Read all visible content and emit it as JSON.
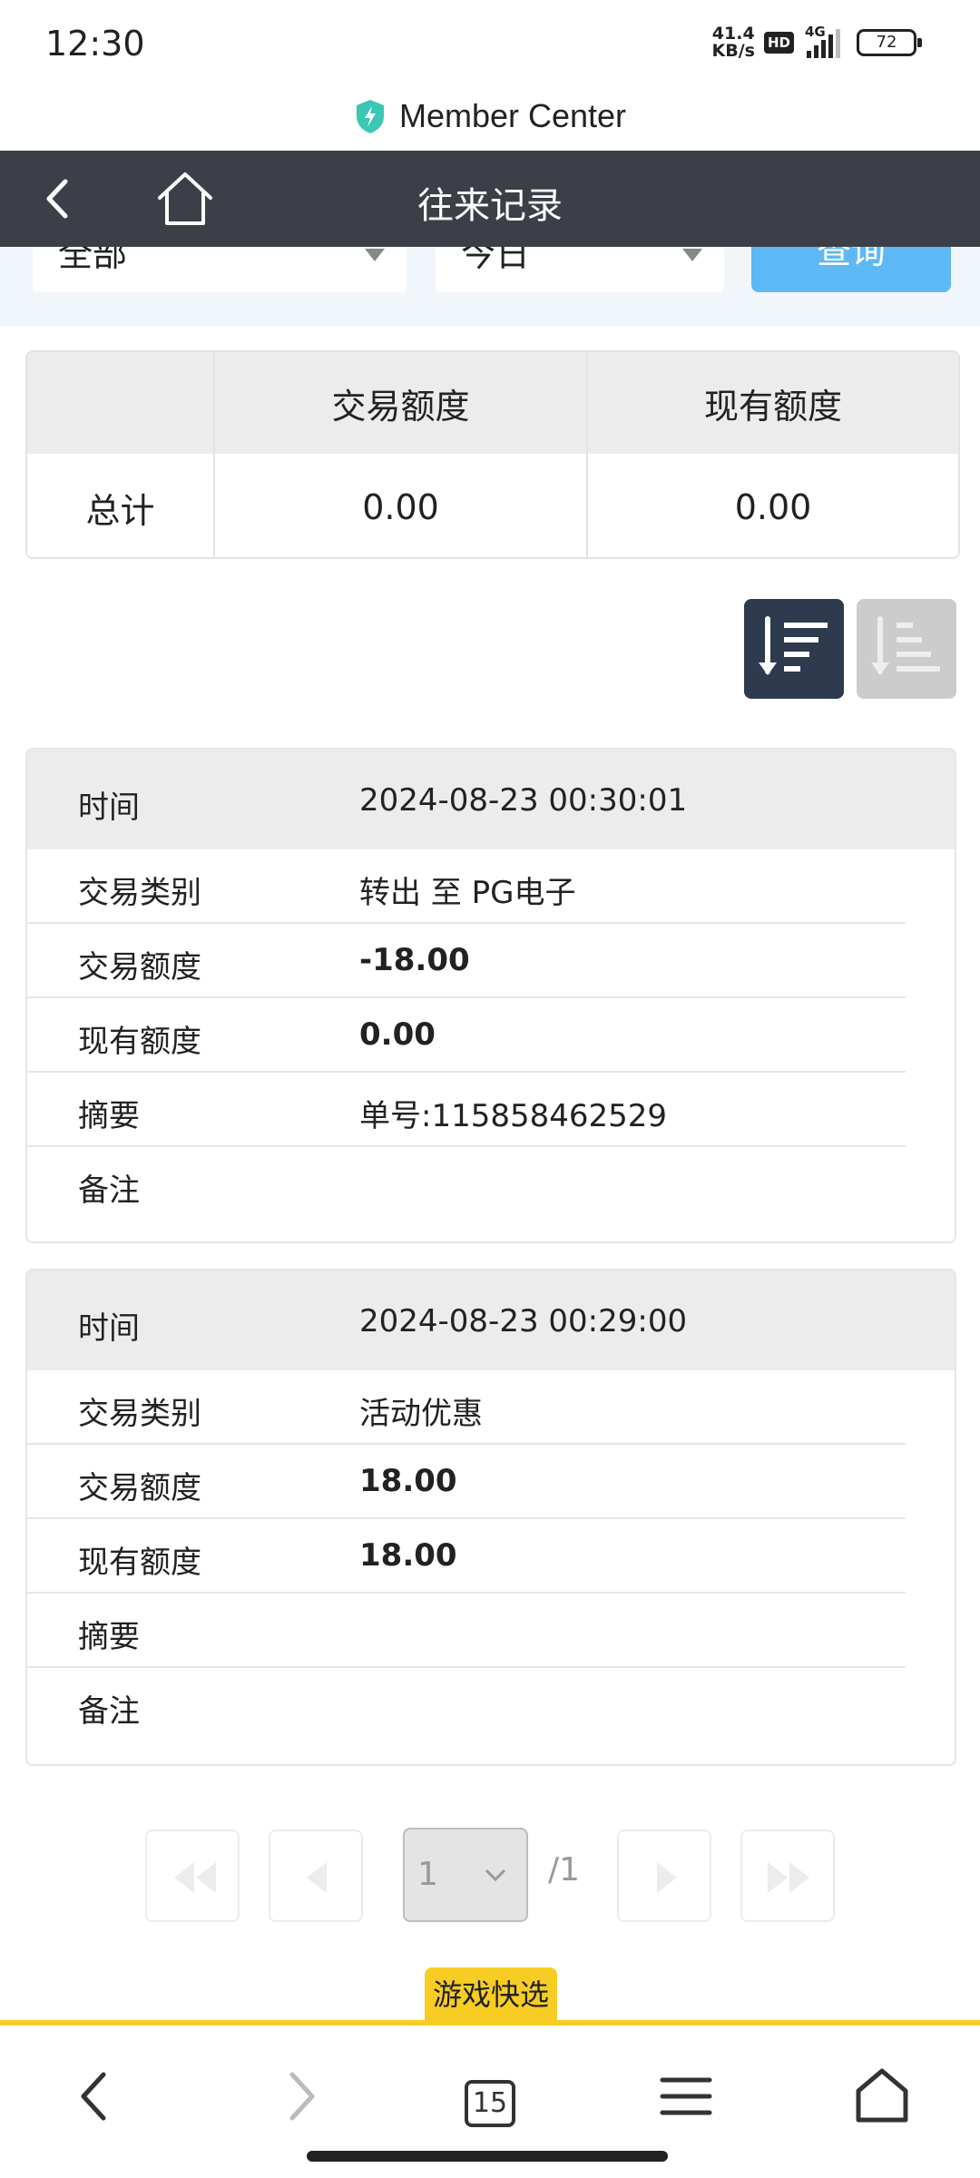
{
  "status_bar": {
    "time": "12:30",
    "net_speed_value": "41.4",
    "net_speed_unit": "KB/s",
    "hd": "HD",
    "network": "4G",
    "battery": "72"
  },
  "browser": {
    "site_title": "Member Center",
    "tab_count": "15"
  },
  "header": {
    "title": "往来记录"
  },
  "filter": {
    "type_value": "全部",
    "date_value": "今日",
    "query_label": "查询"
  },
  "summary": {
    "col_trade": "交易额度",
    "col_balance": "现有额度",
    "row_label": "总计",
    "trade_total": "0.00",
    "balance_total": "0.00"
  },
  "labels": {
    "time": "时间",
    "type": "交易类别",
    "amount": "交易额度",
    "balance": "现有额度",
    "summary": "摘要",
    "remark": "备注"
  },
  "records": [
    {
      "time": "2024-08-23 00:30:01",
      "type": "转出 至 PG电子",
      "amount": "-18.00",
      "balance": "0.00",
      "summary": "单号:115858462529",
      "remark": ""
    },
    {
      "time": "2024-08-23 00:29:00",
      "type": "活动优惠",
      "amount": "18.00",
      "balance": "18.00",
      "summary": "",
      "remark": ""
    }
  ],
  "pager": {
    "current": "1",
    "total": "/1"
  },
  "quick_pick": "游戏快选",
  "colors": {
    "header_bg": "#3c3f47",
    "query_button": "#5eb8f5",
    "sort_active": "#2e3a4d",
    "accent_yellow": "#f7cd23",
    "shield": "#3cc7b4"
  }
}
